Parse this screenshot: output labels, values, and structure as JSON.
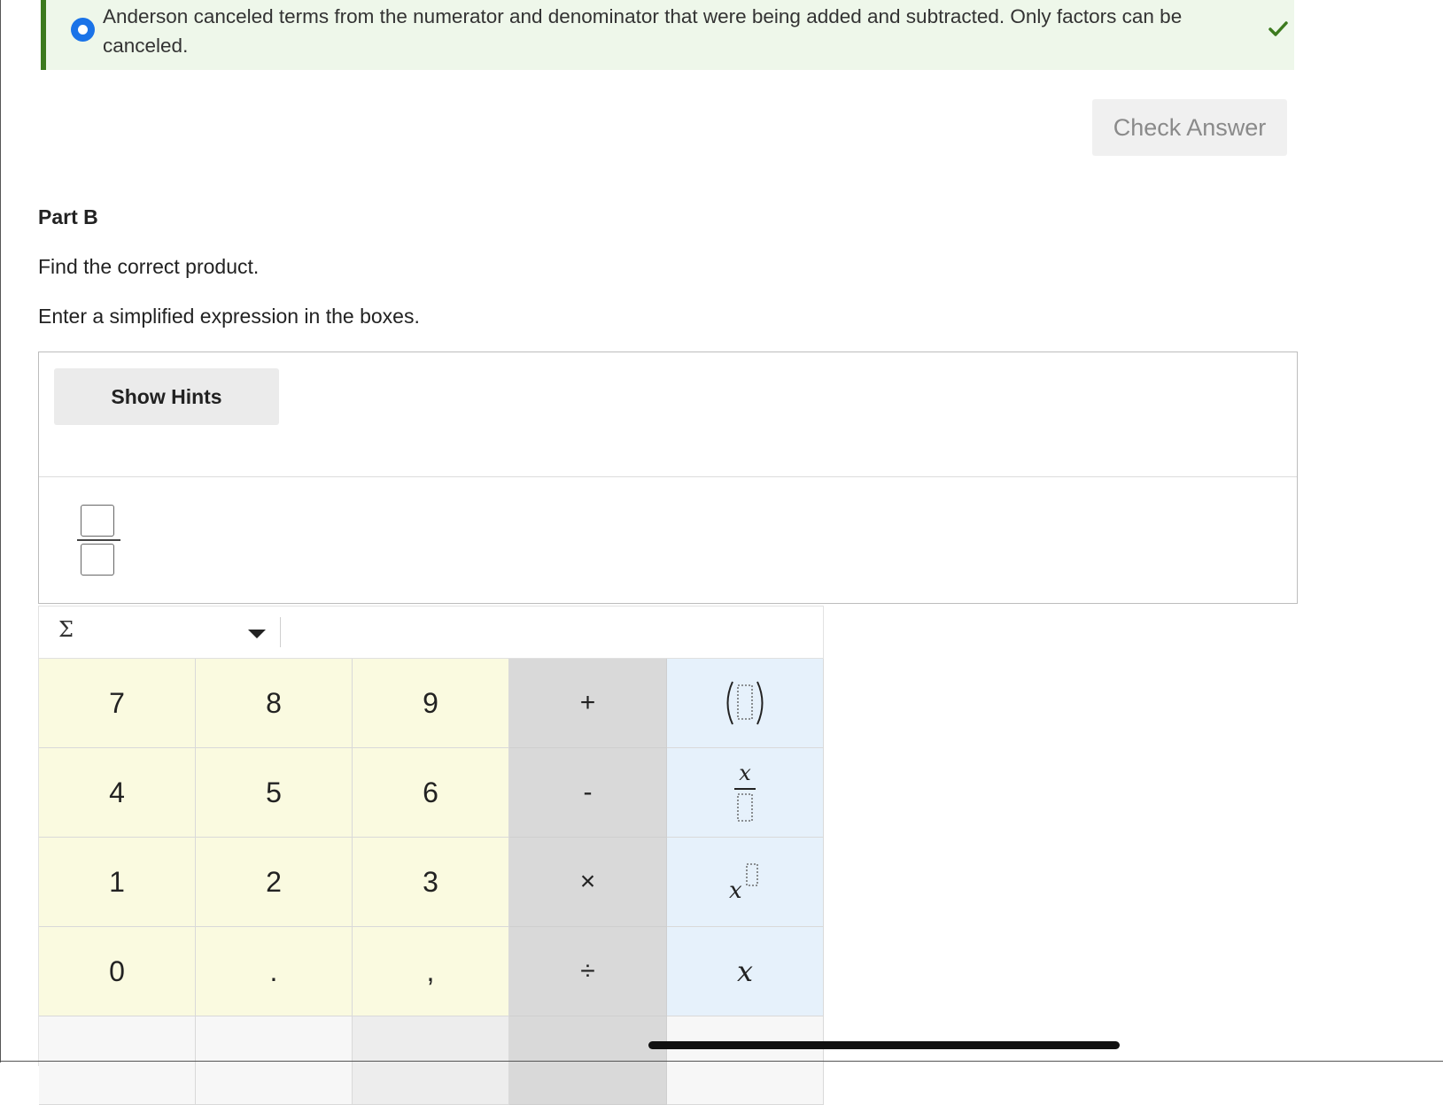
{
  "feedback": {
    "text": "Anderson canceled terms from the numerator and denominator that were being added and subtracted. Only factors can be canceled."
  },
  "check_answer_label": "Check Answer",
  "part": {
    "title": "Part B",
    "prompt": "Find the correct product.",
    "instruction": "Enter a simplified expression in the boxes."
  },
  "hints": {
    "label": "Show Hints"
  },
  "keypad": {
    "mode_symbol": "Σ",
    "keys": {
      "k7": "7",
      "k8": "8",
      "k9": "9",
      "k4": "4",
      "k5": "5",
      "k6": "6",
      "k1": "1",
      "k2": "2",
      "k3": "3",
      "k0": "0",
      "decimal": ".",
      "comma": ",",
      "plus": "+",
      "minus": "-",
      "times": "×",
      "divide": "÷",
      "variable": "x"
    }
  },
  "colors": {
    "feedback_bg": "#eef7ea",
    "feedback_accent": "#3c7a1e",
    "radio": "#1a73e8",
    "digit_key_bg": "#fafae0",
    "operator_key_bg": "#d9d9d9",
    "function_key_bg": "#e6f1fb"
  }
}
